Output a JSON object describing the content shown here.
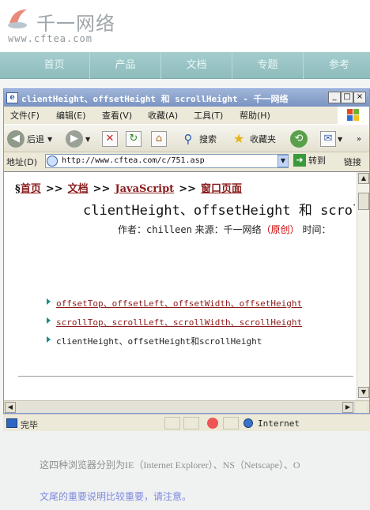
{
  "site": {
    "logo_text": "千一网络",
    "logo_url": "www.cftea.com",
    "nav": [
      "首页",
      "产品",
      "文档",
      "专题",
      "参考"
    ],
    "content_lines": [
      "这四种浏览器分别为IE（Internet Explorer）、NS（Netscape）、O",
      "文尾的重要说明比较重要，请注意。"
    ]
  },
  "window": {
    "title": "clientHeight、offsetHeight 和 scrollHeight - 千一网络",
    "menu": [
      "文件(F)",
      "编辑(E)",
      "查看(V)",
      "收藏(A)",
      "工具(T)",
      "帮助(H)"
    ],
    "toolbar": {
      "back_label": "后退",
      "search_label": "搜索",
      "favorites_label": "收藏夹"
    },
    "address": {
      "label": "地址(D)",
      "url": "http://www.cftea.com/c/751.asp",
      "go_label": "转到",
      "links_label": "链接"
    },
    "status": {
      "text": "完毕",
      "zone": "Internet"
    }
  },
  "page": {
    "breadcrumb": {
      "section_mark": "§",
      "items": [
        "首页",
        "文档",
        "JavaScript",
        "窗口页面"
      ],
      "separator": ">>"
    },
    "title": "clientHeight、offsetHeight 和 scrollHeight",
    "meta": {
      "author_label": "作者：",
      "author": "chilleen",
      "source_label": " 来源：",
      "source": "千一网络",
      "source_tag": "（原创）",
      "time_label": " 时间："
    },
    "related": [
      {
        "text": "offsetTop、offsetLeft、offsetWidth、offsetHeight",
        "link": true
      },
      {
        "text": "scrollTop、scrollLeft、scrollWidth、scrollHeight",
        "link": true
      },
      {
        "text": "clientHeight、offsetHeight和scrollHeight",
        "link": false
      }
    ]
  },
  "colors": {
    "nav_bg": "#9ec7c8",
    "link": "#8a1c1c",
    "accent_red": "#cc0000"
  },
  "icons": [
    "logo-icon",
    "ie-page-icon",
    "minimize-icon",
    "maximize-icon",
    "close-icon",
    "windows-logo-icon",
    "back-icon",
    "forward-icon",
    "stop-icon",
    "refresh-icon",
    "home-icon",
    "search-icon",
    "favorites-icon",
    "history-icon",
    "mail-icon",
    "go-icon",
    "bullet-icon",
    "scroll-up-icon",
    "scroll-down-icon",
    "scroll-left-icon",
    "scroll-right-icon",
    "done-icon",
    "internet-zone-icon"
  ]
}
